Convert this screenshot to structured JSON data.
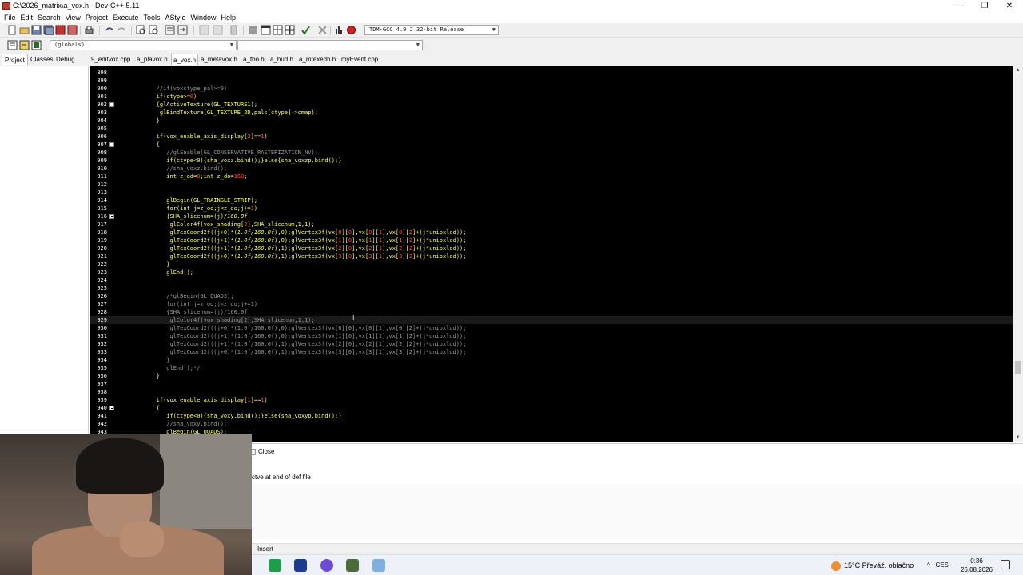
{
  "window": {
    "title": "C:\\2026_matrix\\a_vox.h - Dev-C++ 5.11",
    "minimize_label": "—",
    "maximize_label": "❐",
    "close_label": "✕"
  },
  "menu": [
    "File",
    "Edit",
    "Search",
    "View",
    "Project",
    "Execute",
    "Tools",
    "AStyle",
    "Window",
    "Help"
  ],
  "toolbar": {
    "compiler_select": "TDM-GCC 4.9.2 32-bit Release",
    "scope_select": "(globals)",
    "func_select": ""
  },
  "left_tabs": [
    "Project",
    "Classes",
    "Debug"
  ],
  "file_tabs": [
    "9_editvox.cpp",
    "a_plavox.h",
    "a_vox.h",
    "a_metavox.h",
    "a_fbo.h",
    "a_hud.h",
    "a_mtexedh.h",
    "myEvent.cpp"
  ],
  "active_file_tab": "a_vox.h",
  "editor": {
    "lines": [
      {
        "n": "898",
        "t": ""
      },
      {
        "n": "899",
        "t": ""
      },
      {
        "n": "900",
        "t": "   //if(voxctype_pal>=0)",
        "c": true
      },
      {
        "n": "901",
        "t": "   if(ctype>=0)"
      },
      {
        "n": "902",
        "t": "   {glActiveTexture(GL_TEXTURE1);",
        "f": true
      },
      {
        "n": "903",
        "t": "    glBindTexture(GL_TEXTURE_2D,pals[ctype]->cmap);"
      },
      {
        "n": "904",
        "t": "   }"
      },
      {
        "n": "905",
        "t": ""
      },
      {
        "n": "906",
        "t": "   if(vox_enable_axis_display[2]==1)"
      },
      {
        "n": "907",
        "t": "   {",
        "f": true
      },
      {
        "n": "908",
        "t": "      //glEnable(GL_CONSERVATIVE_RASTERIZATION_NV);",
        "c": true
      },
      {
        "n": "909",
        "t": "      if(ctype<0){sha_voxz.bind();}else{sha_voxzp.bind();}"
      },
      {
        "n": "910",
        "t": "      //sha_voxz.bind();",
        "c": true
      },
      {
        "n": "911",
        "t": "      int z_od=0;int z_do=160;"
      },
      {
        "n": "912",
        "t": ""
      },
      {
        "n": "913",
        "t": ""
      },
      {
        "n": "914",
        "t": "      glBegin(GL_TRAINGLE_STRIP);"
      },
      {
        "n": "915",
        "t": "      for(int j=z_od;j<z_do;j+=1)"
      },
      {
        "n": "916",
        "t": "      {SHA_slicenum=(j)/160.0f;",
        "f": true
      },
      {
        "n": "917",
        "t": "       glColor4f(vox_shading[2],SHA_slicenum,1,1);"
      },
      {
        "n": "918",
        "t": "       glTexCoord2f((j+0)*(1.0f/160.0f),0);glVertex3f(vx[0][0],vx[0][1],vx[0][2]+(j*unipxlod));"
      },
      {
        "n": "919",
        "t": "       glTexCoord2f((j+1)*(1.0f/160.0f),0);glVertex3f(vx[1][0],vx[1][1],vx[1][2]+(j*unipxlod));"
      },
      {
        "n": "920",
        "t": "       glTexCoord2f((j+1)*(1.0f/160.0f),1);glVertex3f(vx[2][0],vx[2][1],vx[2][2]+(j*unipxlod));"
      },
      {
        "n": "921",
        "t": "       glTexCoord2f((j+0)*(1.0f/160.0f),1);glVertex3f(vx[3][0],vx[3][1],vx[3][2]+(j*unipxlod));"
      },
      {
        "n": "922",
        "t": "      }"
      },
      {
        "n": "923",
        "t": "      glEnd();"
      },
      {
        "n": "924",
        "t": ""
      },
      {
        "n": "925",
        "t": ""
      },
      {
        "n": "926",
        "t": "      /*glBegin(GL_QUADS);",
        "c": true
      },
      {
        "n": "927",
        "t": "      for(int j=z_od;j<z_do;j+=1)",
        "c": true
      },
      {
        "n": "928",
        "t": "      {SHA_slicenum=(j)/160.0f;",
        "c": true
      },
      {
        "n": "929",
        "t": "       glColor4f(vox_shading[2],SHA_slicenum,1,1);",
        "c": true,
        "cur": true
      },
      {
        "n": "930",
        "t": "       glTexCoord2f((j+0)*(1.0f/160.0f),0);glVertex3f(vx[0][0],vx[0][1],vx[0][2]+(j*unipxlod));",
        "c": true
      },
      {
        "n": "931",
        "t": "       glTexCoord2f((j+1)*(1.0f/160.0f),0);glVertex3f(vx[1][0],vx[1][1],vx[1][2]+(j*unipxlod));",
        "c": true
      },
      {
        "n": "932",
        "t": "       glTexCoord2f((j+1)*(1.0f/160.0f),1);glVertex3f(vx[2][0],vx[2][1],vx[2][2]+(j*unipxlod));",
        "c": true
      },
      {
        "n": "933",
        "t": "       glTexCoord2f((j+0)*(1.0f/160.0f),1);glVertex3f(vx[3][0],vx[3][1],vx[3][2]+(j*unipxlod));",
        "c": true
      },
      {
        "n": "934",
        "t": "      }",
        "c": true
      },
      {
        "n": "935",
        "t": "      glEnd();*/",
        "c": true
      },
      {
        "n": "936",
        "t": "   }"
      },
      {
        "n": "937",
        "t": ""
      },
      {
        "n": "938",
        "t": ""
      },
      {
        "n": "939",
        "t": "   if(vox_enable_axis_display[1]==1)"
      },
      {
        "n": "940",
        "t": "   {",
        "f": true
      },
      {
        "n": "941",
        "t": "      if(ctype<0){sha_voxy.bind();}else{sha_voxyp.bind();}"
      },
      {
        "n": "942",
        "t": "      //sha_voxy.bind();",
        "c": true
      },
      {
        "n": "943",
        "t": "      glBegin(GL_QUADS);"
      }
    ]
  },
  "bottom": {
    "close_label": "Close",
    "message": "ctve at end of def file"
  },
  "status": {
    "mode": "Insert"
  },
  "taskbar": {
    "weather": "15°C  Převáž. oblačno",
    "lang": "CES",
    "time": "0:36",
    "date": "26.08.2026",
    "tray_chevron": "^"
  },
  "colors": {
    "editor_bg": "#000000",
    "code": "#ffff66",
    "comment": "#9a9a9a",
    "number": "#ff5050",
    "line_number": "#ffffff"
  }
}
